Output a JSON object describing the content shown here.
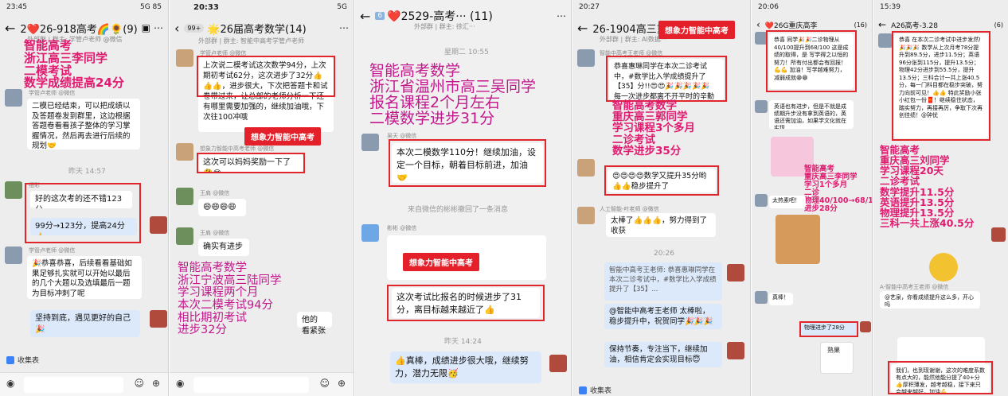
{
  "panels": [
    {
      "status_time": "23:45",
      "status_right": "5G 85",
      "title": "2❤️26-918高考🌈🌻(9)",
      "subtitle": "外部群 | 群主: 学管卢老师 @微信",
      "overlay": [
        "智能高考",
        "浙江高三李同学",
        "二模考试",
        "数学成绩提高24分"
      ],
      "msg1": "二模已经结束，可以把成绩以及答题卷发到群里，这边根据答题卷看看孩子整体的学习掌握情况，然后再去进行后续的规划🤝",
      "time_label": "昨天 14:57",
      "name1": "细彩",
      "msg2": "好的这次考的还不错123分",
      "msg3": "99分→123分，提高24分👍",
      "name2": "学管卢老师 @微信",
      "msg4": "🎉恭喜恭喜，后续看看基础如果足够扎实就可以开始以最后的几个大题以及选填最后一题为目标冲刺了呢",
      "msg5": "坚持到底，遇见更好的自己🎉",
      "fav": "收集表"
    },
    {
      "status_time": "20:33",
      "status_right": "5G",
      "badge": "99+",
      "title": "🌟26届高考数学(14)",
      "subtitle": "外部群 | 群主: 智能中高考学管卢老师",
      "name0": "学管卢老师 @微信",
      "msg1": "上次说二模考试这次数学94分，上次期初考试62分，这次进步了32分👍👍👍，进步很大，下次把答题卡和试卷带过来，让总部的老师分析一下还有哪里需要加强的，继续加油哦，下次往100冲哦",
      "brand": "想象力智能中高考",
      "name1": "想象力智能中高考老师 @微信",
      "msg2": "这次可以妈妈奖励一下了🤔😊",
      "name2": "王肩 @微信",
      "msg3": "😄😄😄😄",
      "name3": "王肩 @微信",
      "msg4": "确实有进步",
      "msg5": "他的",
      "msg6": "看紧张",
      "overlay": [
        "智能高考数学",
        "浙江宁波高三陆同学",
        "学习课程两个月",
        "本次二模考试94分",
        "相比期初考试",
        "进步32分"
      ]
    },
    {
      "badge": "6",
      "title": "❤️2529-高考··· (11)",
      "subtitle": "外部群 | 群主: 徐汇···",
      "time1": "星期二 10:55",
      "overlay": [
        "智能高考数学",
        "浙江省温州市高三吴同学",
        "报名课程2个月左右",
        "二模数学进步31分"
      ],
      "name1": "吴天 @微信",
      "msg1": "本次二模数学110分！继续加油，设定一个目标，朝着目标前进，加油🤝",
      "recall": "来自微信的彬彬撤回了一条消息",
      "name2": "彬彬 @微信",
      "brand": "想象力智能中高考",
      "msg2": "这次考试比报名的时候进步了31分，离目标越来越近了👍",
      "time2": "昨天 14:24",
      "msg3": "👍真棒，成绩进步很大哦，继续努力，潜力无限🥳"
    },
    {
      "status_time": "20:27",
      "title": "26-1904高三重",
      "subtitle": "外部群 | 群主: AI数据···",
      "brand": "想象力智能中高考",
      "name0": "智能中高考王老师 @微信",
      "msg1": "恭喜惠琳同学在本次二诊考试中，#数学比入学成绩提升了【35】分!!😍😍🎉🎉🎉🎉🎉 每一次进步都离不开平时的辛勤",
      "overlay": [
        "智能高考数学",
        "重庆高三郭同学",
        "学习课程3个多月",
        "二诊考试",
        "数学进步35分"
      ],
      "msg2": "😍😍😍😍数学又提升35分哟👍👍稳步提升了",
      "name3": "人工智能-叶老师 @微信",
      "msg3": "太棒了👍👍👍，努力得到了收获",
      "time1": "20:26",
      "quote": "智能中高考王老师: 恭喜惠琳同学在本次二诊考试中，#数学比入学成绩提升了【35】...",
      "msg4": "@智能中高考王老师 太棒啦，稳步提升中，祝贺同学🎉🎉🎉",
      "msg5": "保持节奏，专注当下，继续加油，相信肯定会实现目标😇",
      "fav": "收集表"
    },
    {
      "status_time": "20:06",
      "title": "❤️26G重庆高李",
      "count": "(16)",
      "msg1": "恭喜  同学🎉🎉二诊物理从40/100提升到68/100 这是成绩的取得，是 写学得之以恒的努力！所有付出都会有回报！💪💪 加油！写学越难努力，减弱成就😁😁",
      "msg2": "英语也有进步，但是不就是成绩期升步没有拿到英语的，英语还需加油，如果学文化就在实现",
      "overlay": [
        "智能高考",
        "重庆高三李同学",
        "学习1个多月",
        "二诊",
        "物理40/100→68/100",
        "进步28分"
      ],
      "msg3": "太热素吧！",
      "msg4": "真棒！",
      "msg5": "物理进步了28分",
      "sticker_text": "熟果"
    },
    {
      "status_time": "15:39",
      "title": "A26高考-3.28",
      "count": "(6)",
      "msg1": "恭喜  在本次二诊考试中进步发然! 🎉🎉🎉 数学从上次月考78分提升到89.5分，进步11.5分；英语96分张到115分，提升13.5分；物理42分进步到55.5分，提升13.5分；三科合计一共上涨40.5分，每一门科目都在稳步突破，努力向前可见！👍👍 特此奖励小张小红包一份🧧！继续稳住状态，踏实努力，再接再厉，争取下次再创佳绩！@钟忧",
      "overlay_title": [
        "智能高考",
        "重庆高三刘同学",
        "学习课程20天",
        "二诊考试"
      ],
      "overlay_gains": [
        "数学提升11.5分",
        "英语提升13.5分",
        "物理提升13.5分",
        "三科一共上涨40.5分"
      ],
      "name1": "A-智能中高考王老师 @微信",
      "msg2": "@艺泉，你看成绩提升这么多，开心吗",
      "msg3": "我们，也到现谢谢，这次的难度系数有点大的，能然他能分提了40+分👍厚积薄发，越考越稳，接下来只会越来越好，加油💪"
    }
  ],
  "colors": {
    "overlay_magenta": "#e01a6f",
    "overlay_purple": "#c2188c",
    "frame_red": "#e0252b",
    "bubble_green": "#95ec69",
    "chat_bg": "#ededed"
  }
}
